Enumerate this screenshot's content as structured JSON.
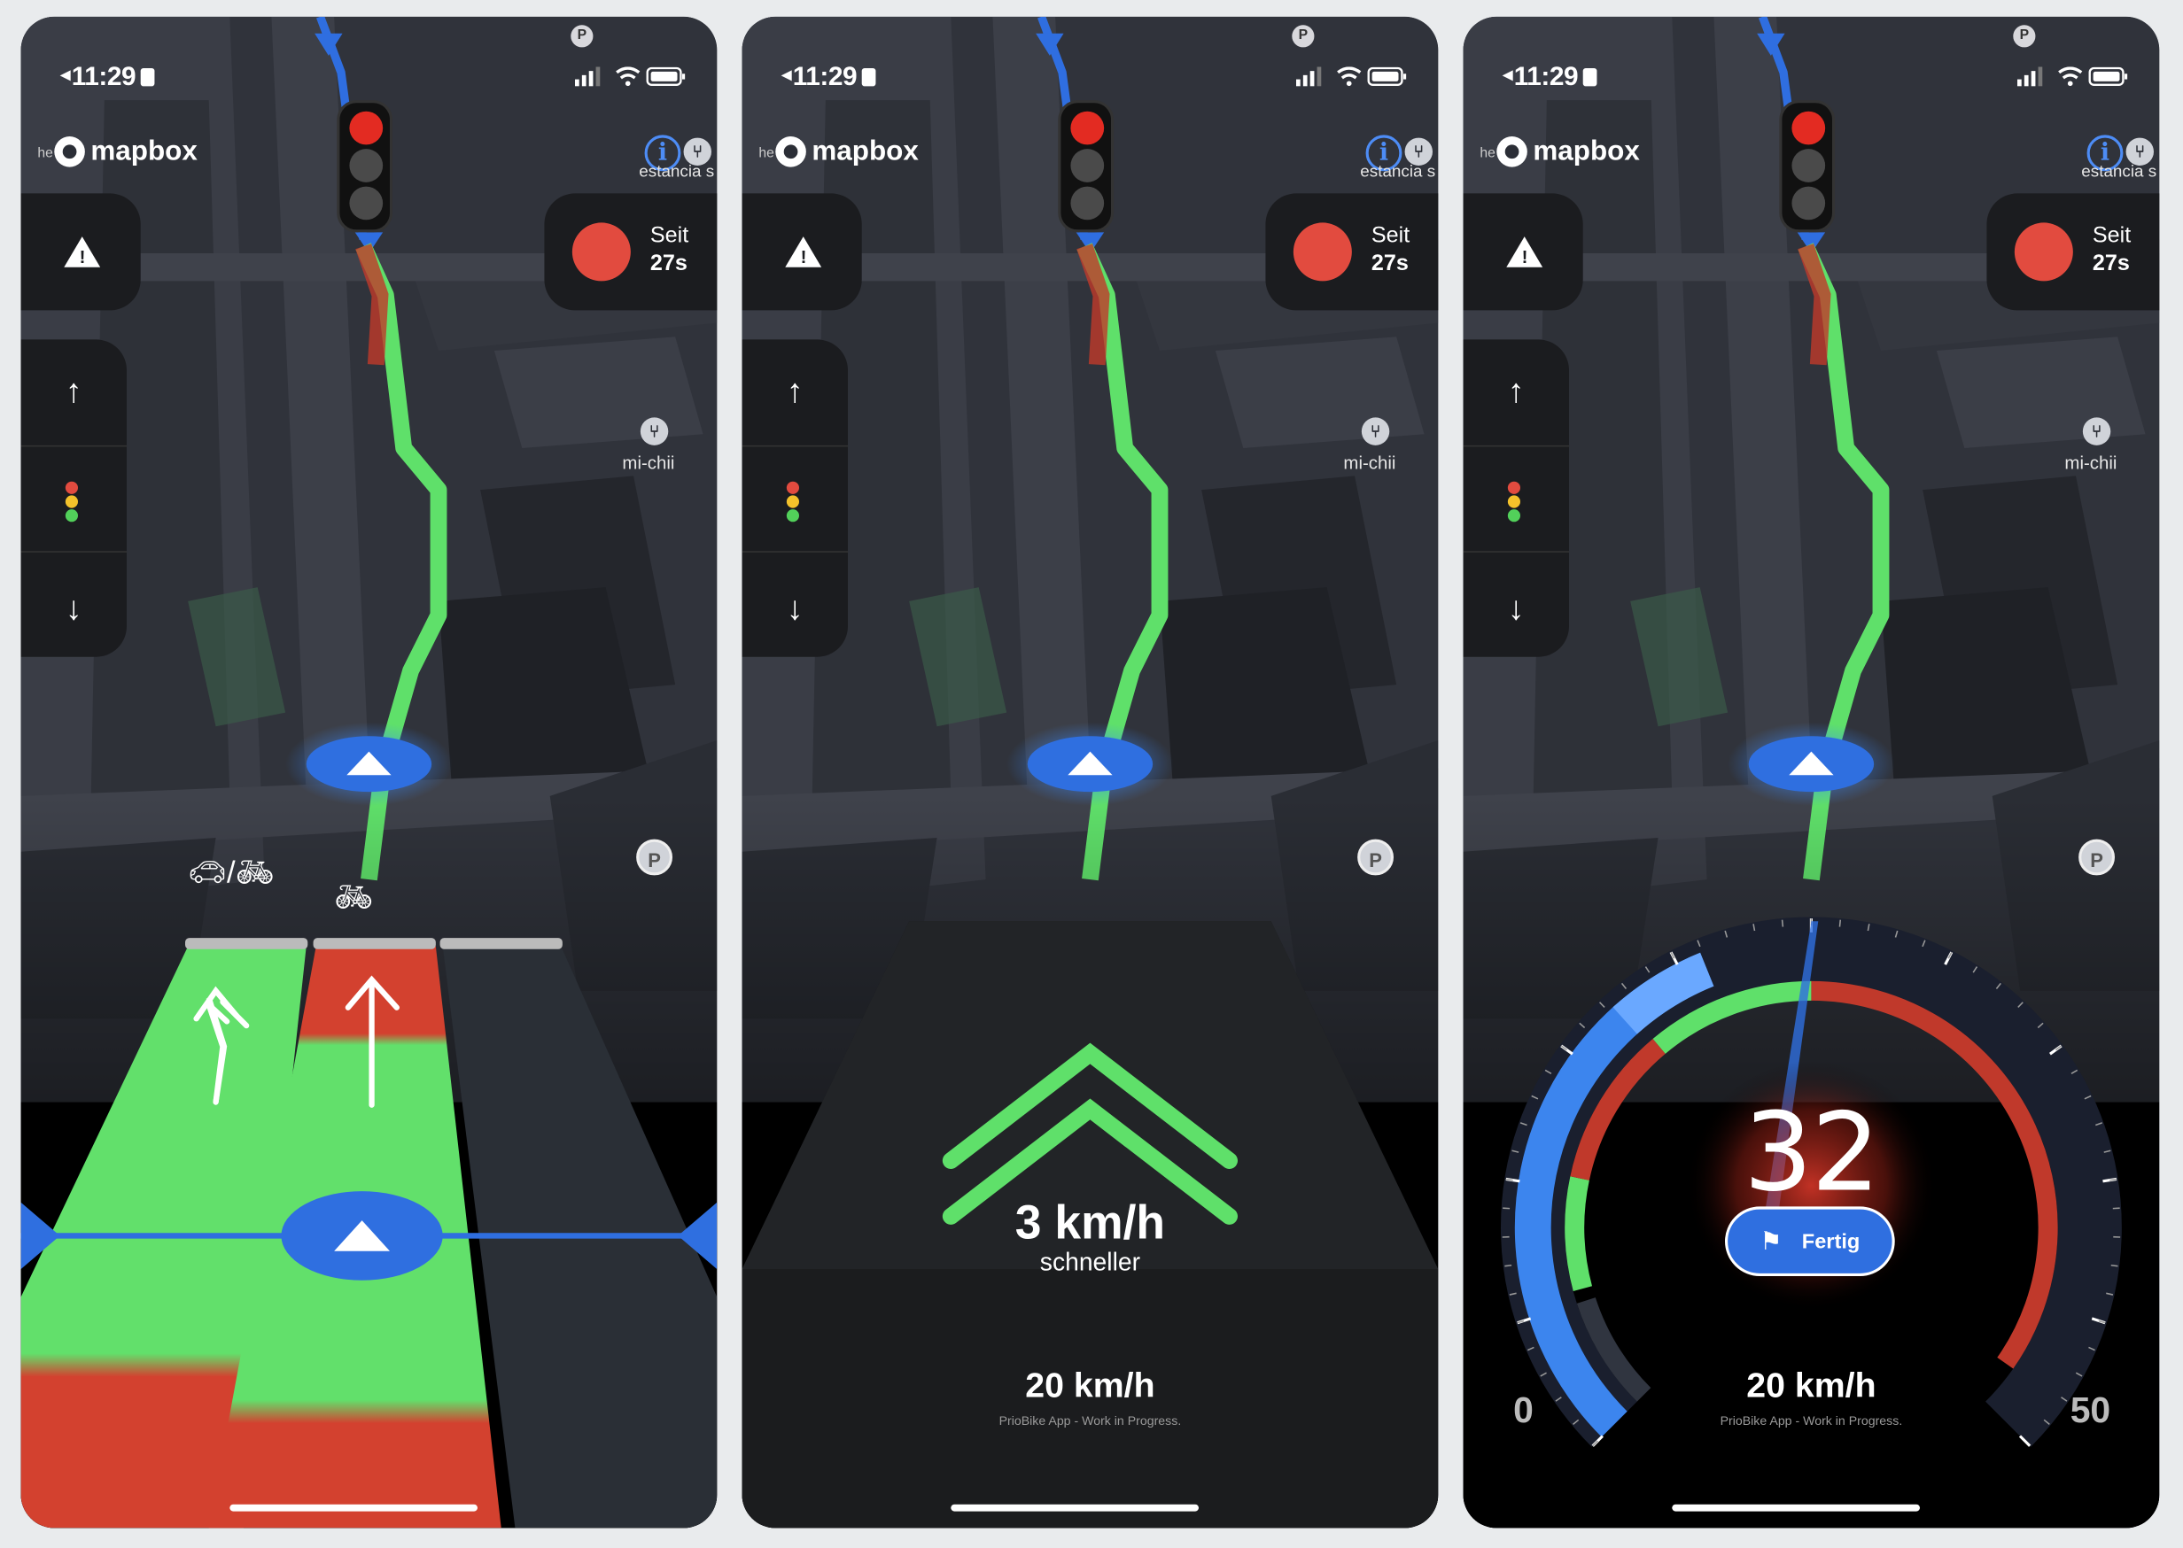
{
  "status_bar": {
    "time": "11:29"
  },
  "map": {
    "brand": "mapbox",
    "brand_prefix": "he",
    "info_icon": "info-icon",
    "poi_top_label": "estancia s",
    "poi_mid_label": "mi-chii",
    "parking_label": "P",
    "route_color": "#5fe06a"
  },
  "controls": {
    "warning_icon": "warning-icon",
    "up_icon": "arrow-up-icon",
    "down_icon": "arrow-down-icon",
    "up_glyph": "↑",
    "down_glyph": "↓"
  },
  "status_card": {
    "line1": "Seit",
    "line2": "27s",
    "light_color": "#e24b3f"
  },
  "screens": [
    {
      "mode": "lanes"
    },
    {
      "mode": "advice",
      "advice_speed": "3 km/h",
      "advice_text": "schneller",
      "speed": "20 km/h",
      "credit": "PrioBike App - Work in Progress."
    },
    {
      "mode": "gauge",
      "current_speed": "32",
      "button_label": "Fertig",
      "speed": "20 km/h",
      "credit": "PrioBike App - Work in Progress.",
      "gauge_min": "0",
      "gauge_max": "50"
    }
  ]
}
